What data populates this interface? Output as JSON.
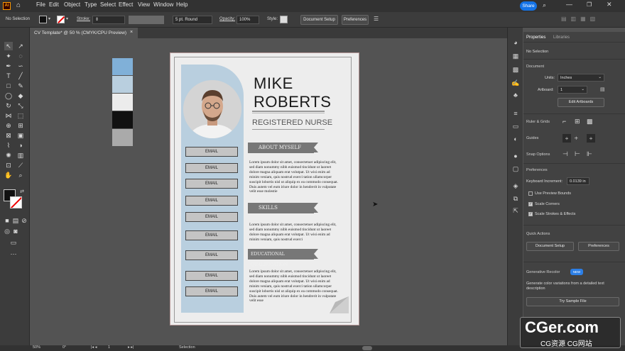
{
  "app": {
    "logo": "Ai",
    "share_label": "Share"
  },
  "menu": [
    "File",
    "Edit",
    "Object",
    "Type",
    "Select",
    "Effect",
    "View",
    "Window",
    "Help"
  ],
  "control": {
    "selection": "No Selection",
    "stroke_label": "Stroke:",
    "brush_value": "5 pt. Round",
    "opacity_label": "Opacity:",
    "opacity_value": "100%",
    "style_label": "Style:",
    "document_setup": "Document Setup",
    "preferences": "Preferences"
  },
  "tab": {
    "title": "CV Template* @ 50 % (CMYK/CPU Preview)",
    "close": "×"
  },
  "swatches": [
    "#80b0d8",
    "#b9cfdf",
    "#ececec",
    "#111111",
    "#aaaaaa"
  ],
  "cv": {
    "first_name": "MIKE",
    "last_name": "ROBERTS",
    "role": "REGISTERED NURSE",
    "email_label": "EMAIL",
    "emails": [
      "EMAIL",
      "EMAIL",
      "EMAIL",
      "EMAIL",
      "EMAIL",
      "EMAIL",
      "EMAIL",
      "EMAIL",
      "EMAIL"
    ],
    "sections": {
      "about": "ABOUT MYSELF",
      "skills": "SKILLS",
      "education": "EDUCATIONAL QUALIFICATION"
    },
    "about_text": "Lorem ipsum dolor sit amet, consectetuer adipiscing elit, sed diam nonummy nibh euismod tincidunt ut laoreet dolore magna aliquam erat volutpat. Ut wisi enim ad minim veniam, quis nostrud exerci tation ullamcorper suscipit lobortis nisl ut aliquip ex ea commodo consequat. Duis autem vel eum iriure dolor in hendrerit in vulputate velit esse molestie",
    "skills_text": "Lorem ipsum dolor sit amet, consectetuer adipiscing elit, sed diam nonummy nibh euismod tincidunt ut laoreet dolore magna aliquam erat volutpat. Ut wisi enim ad minim veniam, quis nostrud exerci",
    "education_text": "Lorem ipsum dolor sit amet, consectetuer adipiscing elit, sed diam nonummy nibh euismod tincidunt ut laoreet dolore magna aliquam erat volutpat. Ut wisi enim ad minim veniam, quis nostrud exerci tation ullamcorper suscipit lobortis nisl ut aliquip ex ea commodo consequat. Duis autem vel eum iriure dolor in hendrerit in vulputate velit esse"
  },
  "panel": {
    "tab_properties": "Properties",
    "tab_libraries": "Libraries",
    "no_selection": "No Selection",
    "document": "Document",
    "units_label": "Units:",
    "units_value": "Inches",
    "artboard_label": "Artboard:",
    "artboard_value": "1",
    "edit_artboards": "Edit Artboards",
    "rulers_grids": "Ruler & Grids",
    "guides": "Guides",
    "snap_options": "Snap Options",
    "preferences": "Preferences",
    "keyboard_increment_label": "Keyboard Increment:",
    "keyboard_increment_value": "0.0139 in",
    "use_preview_bounds": "Use Preview Bounds",
    "scale_corners": "Scale Corners",
    "scale_strokes": "Scale Strokes & Effects",
    "quick_actions": "Quick Actions",
    "document_setup": "Document Setup",
    "preferences_btn": "Preferences",
    "generative_recolor": "Generative Recolor",
    "new_badge": "NEW",
    "recolor_desc": "Generate color variations from a detailed text description",
    "try_sample": "Try Sample File"
  },
  "status": {
    "zoom": "50%",
    "rotation": "0°",
    "page": "1",
    "mode": "Selection"
  },
  "watermark": {
    "main": "CGer.com",
    "sub": "CG资源 CG网站"
  }
}
